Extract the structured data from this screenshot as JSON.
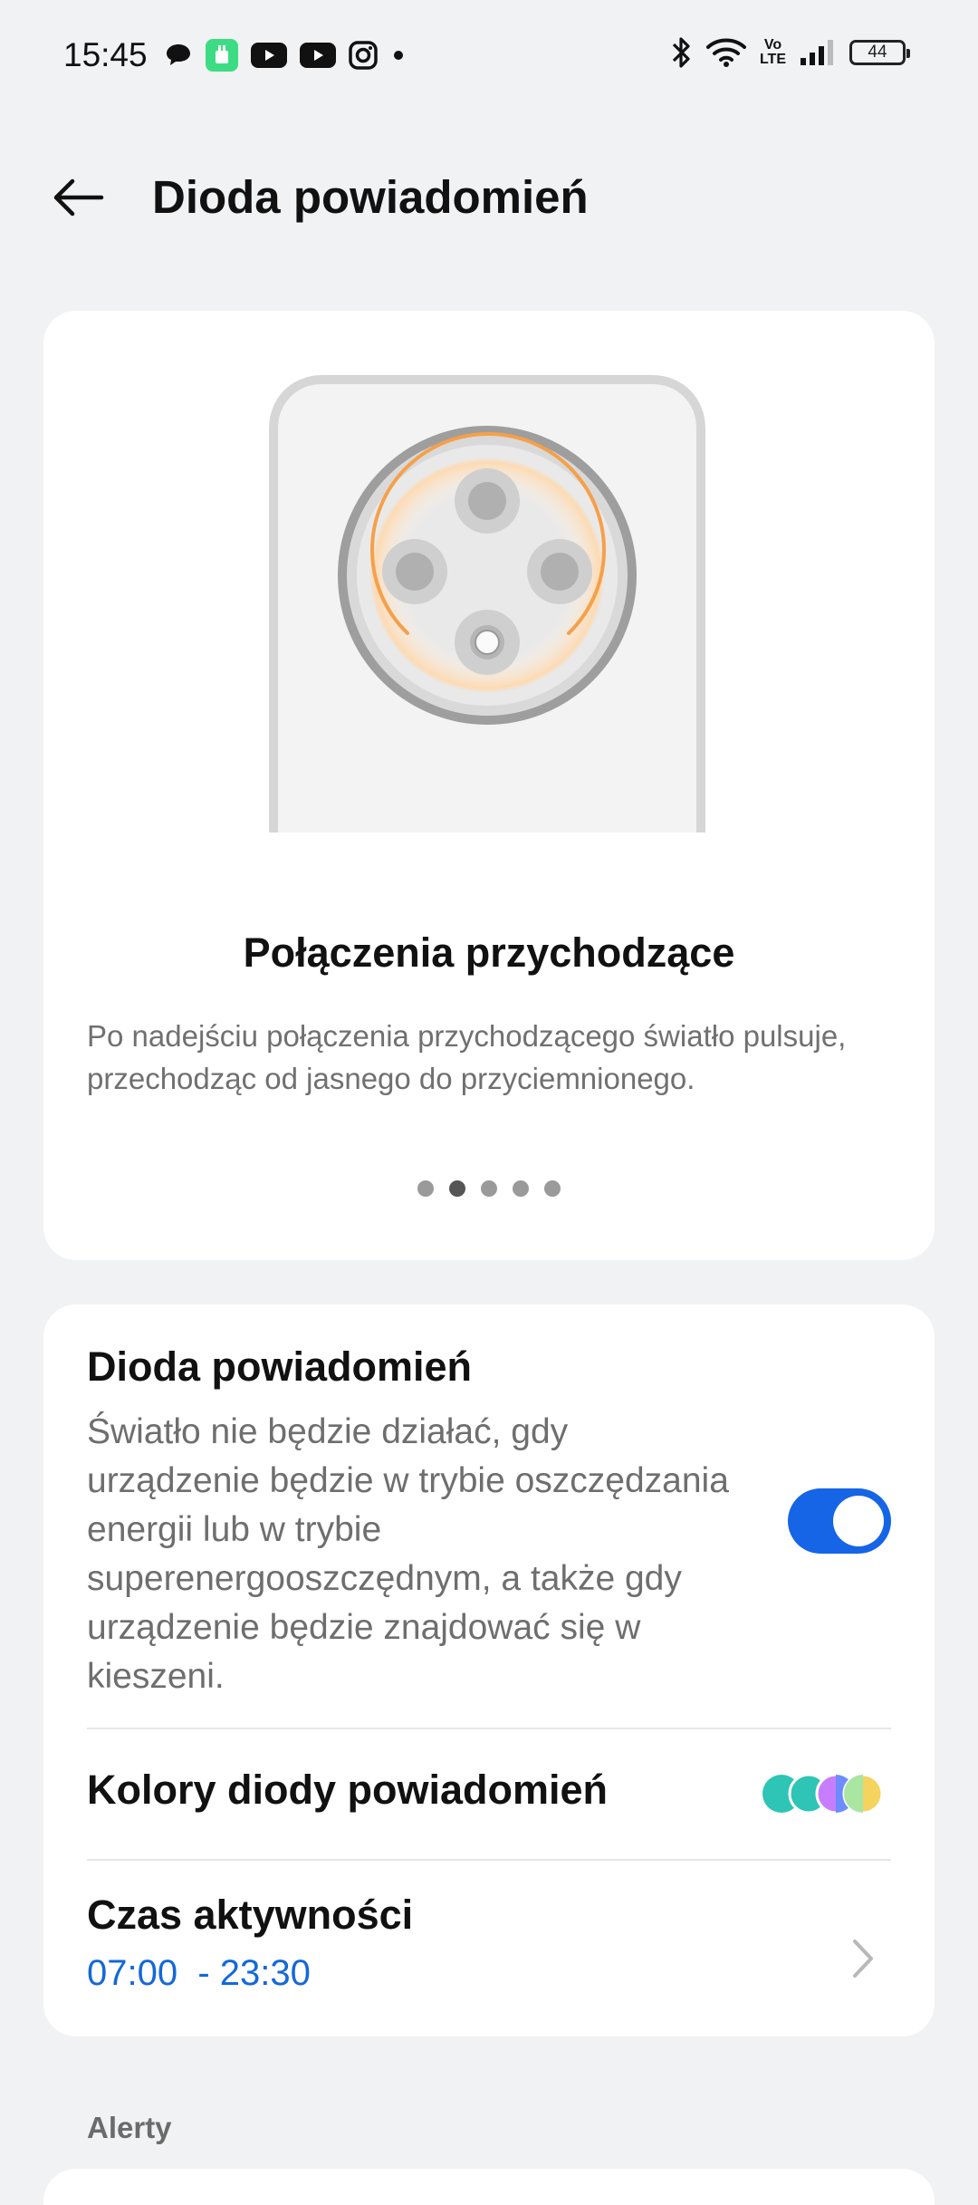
{
  "status_bar": {
    "time": "15:45",
    "left_icons": [
      "chat-bubble-icon",
      "android-app-icon",
      "youtube-icon",
      "youtube-icon",
      "instagram-icon",
      "more-dot-icon"
    ],
    "right_icons": [
      "bluetooth-icon",
      "wifi-icon",
      "volte-icon",
      "signal-icon",
      "battery-icon"
    ],
    "volte_text_top": "Vo",
    "volte_text_bottom": "LTE",
    "battery_level": "44"
  },
  "header": {
    "title": "Dioda powiadomień",
    "back_icon": "arrow-left-icon"
  },
  "preview": {
    "title": "Połączenia przychodzące",
    "description": "Po nadejściu połączenia przychodzącego światło pulsuje, przechodząc od jasnego do przyciemnionego.",
    "page_count": 5,
    "active_page": 2,
    "glow_color": "#f5a04a"
  },
  "settings": {
    "led": {
      "title": "Dioda powiadomień",
      "description": "Światło nie będzie działać, gdy urządzenie będzie w trybie oszczędzania energii lub w trybie superenergooszczędnym, a także gdy urządzenie będzie znajdować się w kieszeni.",
      "enabled": true,
      "toggle_color": "#1565e6"
    },
    "colors": {
      "title": "Kolory diody powiadomień",
      "swatches": [
        "#2ec4b6",
        "#2ec4b6",
        "#c77dff",
        "#f4d35e"
      ]
    },
    "active_time": {
      "title": "Czas aktywności",
      "range": "07:00  - 23:30",
      "chevron_icon": "chevron-right-icon"
    }
  },
  "alerts_section": {
    "label": "Alerty"
  }
}
